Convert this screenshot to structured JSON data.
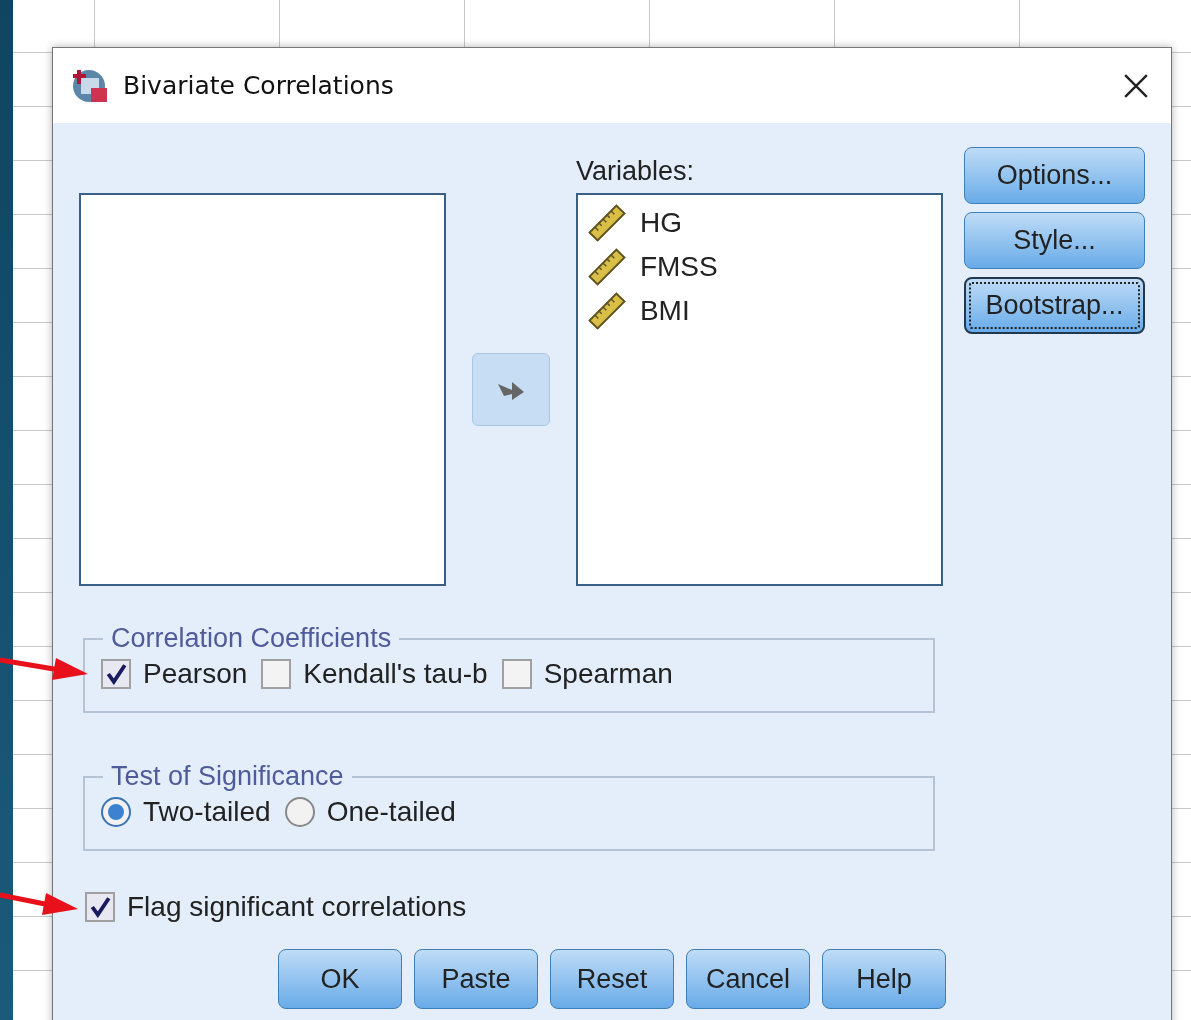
{
  "window": {
    "title": "Bivariate Correlations"
  },
  "variables": {
    "label": "Variables:",
    "items": [
      {
        "name": "HG"
      },
      {
        "name": "FMSS"
      },
      {
        "name": "BMI"
      }
    ]
  },
  "side_buttons": [
    {
      "label": "Options...",
      "focused": false
    },
    {
      "label": "Style...",
      "focused": false
    },
    {
      "label": "Bootstrap...",
      "focused": true
    }
  ],
  "correlation_coefficients": {
    "title": "Correlation Coefficients",
    "options": [
      {
        "label": "Pearson",
        "checked": true
      },
      {
        "label": "Kendall's tau-b",
        "checked": false
      },
      {
        "label": "Spearman",
        "checked": false
      }
    ]
  },
  "test_of_significance": {
    "title": "Test of Significance",
    "options": [
      {
        "label": "Two-tailed",
        "selected": true
      },
      {
        "label": "One-tailed",
        "selected": false
      }
    ]
  },
  "flag_significant": {
    "label": "Flag significant correlations",
    "checked": true
  },
  "buttons": [
    "OK",
    "Paste",
    "Reset",
    "Cancel",
    "Help"
  ]
}
